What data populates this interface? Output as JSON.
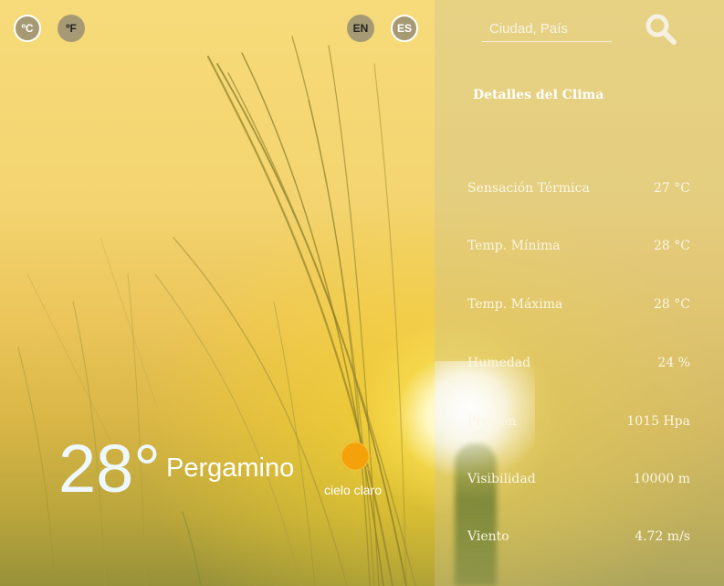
{
  "units": {
    "celsius_label": "ºC",
    "fahrenheit_label": "ºF"
  },
  "languages": {
    "en_label": "EN",
    "es_label": "ES"
  },
  "current": {
    "temperature": "28°",
    "city": "Pergamino",
    "description": "cielo claro",
    "icon": "sun-icon"
  },
  "search": {
    "placeholder": "Ciudad, País",
    "icon": "search-icon"
  },
  "details": {
    "title": "Detalles del Clima",
    "rows": [
      {
        "label": "Sensación Térmica",
        "value": "27 °C"
      },
      {
        "label": "Temp. Mínima",
        "value": "28 °C"
      },
      {
        "label": "Temp. Máxima",
        "value": "28 °C"
      },
      {
        "label": "Humedad",
        "value": "24 %"
      },
      {
        "label": "Presión",
        "value": "1015 Hpa"
      },
      {
        "label": "Visibilidad",
        "value": "10000 m"
      },
      {
        "label": "Viento",
        "value": "4.72 m/s"
      }
    ]
  },
  "colors": {
    "sun": "#f5a20a",
    "button_bg": "#a59a74",
    "panel_text": "#fbf6e4"
  }
}
